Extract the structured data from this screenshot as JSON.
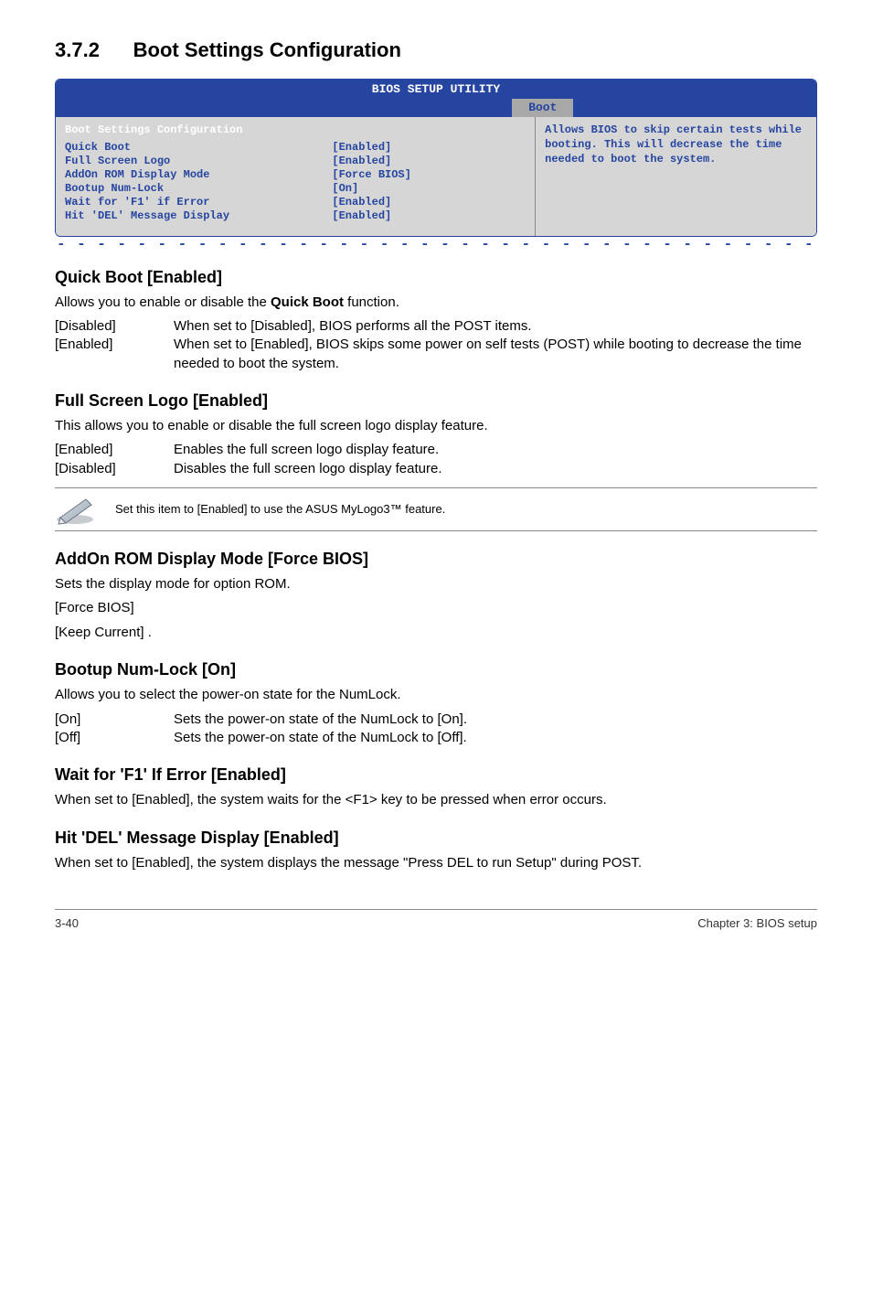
{
  "heading_number": "3.7.2",
  "heading_title": "Boot Settings Configuration",
  "bios": {
    "utility_title": "BIOS SETUP UTILITY",
    "tab": "Boot",
    "panel_title": "Boot Settings Configuration",
    "rows": [
      {
        "k": "Quick Boot",
        "v": "[Enabled]"
      },
      {
        "k": "Full Screen Logo",
        "v": "[Enabled]"
      },
      {
        "k": "AddOn ROM Display Mode",
        "v": "[Force BIOS]"
      },
      {
        "k": "Bootup Num-Lock",
        "v": "[On]"
      },
      {
        "k": "Wait for 'F1' if Error",
        "v": "[Enabled]"
      },
      {
        "k": "Hit 'DEL' Message Display",
        "v": "[Enabled]"
      }
    ],
    "help": "Allows BIOS to skip certain tests while booting. This will decrease the time needed to boot the system."
  },
  "quickboot": {
    "title": "Quick Boot [Enabled]",
    "desc_pre": "Allows you to enable or disable the ",
    "desc_bold": "Quick Boot",
    "desc_post": " function.",
    "opts": [
      {
        "k": "[Disabled]",
        "v": "When set to [Disabled], BIOS performs all the POST items."
      },
      {
        "k": "[Enabled]",
        "v": "When set to [Enabled], BIOS skips some power on self tests (POST) while booting to decrease the time needed to boot the system."
      }
    ]
  },
  "fullscreen": {
    "title": "Full Screen Logo [Enabled]",
    "desc": "This allows you to enable or disable the full screen logo display feature.",
    "opts": [
      {
        "k": "[Enabled]",
        "v": "Enables the full screen logo display feature."
      },
      {
        "k": "[Disabled]",
        "v": "Disables the full screen logo display feature."
      }
    ]
  },
  "note_text": "Set this item to [Enabled] to use the ASUS MyLogo3™ feature.",
  "addon": {
    "title": "AddOn ROM Display Mode [Force BIOS]",
    "desc": "Sets the display mode for option ROM.",
    "lines": [
      "[Force BIOS]",
      "[Keep Current]  ."
    ]
  },
  "numlock": {
    "title": "Bootup Num-Lock [On]",
    "desc": "Allows you to select the power-on state for the NumLock.",
    "opts": [
      {
        "k": "[On]",
        "v": "Sets the power-on state of the NumLock to [On]."
      },
      {
        "k": "[Off]",
        "v": "Sets the power-on state of the NumLock to [Off]."
      }
    ]
  },
  "waitf1": {
    "title": "Wait for 'F1' If Error [Enabled]",
    "desc": "When set to [Enabled], the system waits for the <F1> key to be pressed when error occurs."
  },
  "hitdel": {
    "title": "Hit 'DEL' Message Display [Enabled]",
    "desc": "When set to [Enabled], the system displays the message \"Press DEL to run Setup\" during POST."
  },
  "footer": {
    "left": "3-40",
    "right": "Chapter 3: BIOS setup"
  }
}
